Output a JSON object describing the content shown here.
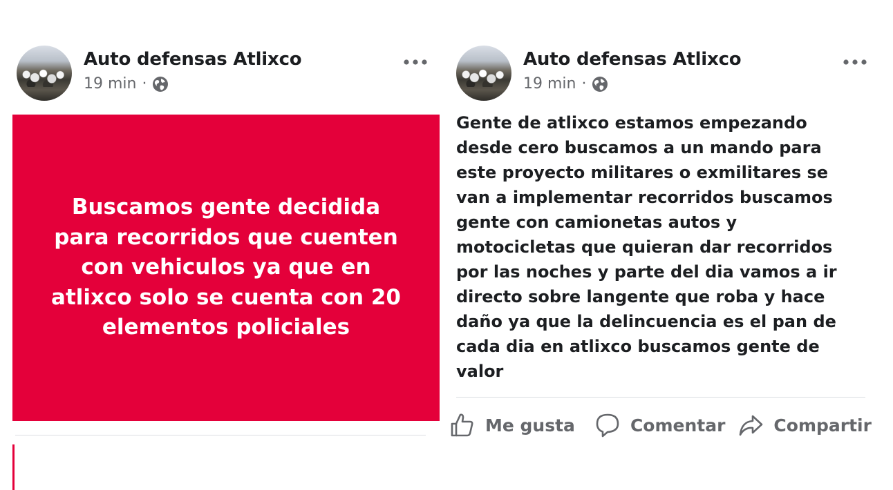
{
  "left_post": {
    "author": "Auto defensas Atlixco",
    "time": "19 min",
    "separator": "·",
    "audience_icon": "globe-icon",
    "menu_icon": "more-options-icon",
    "card": {
      "text": "Buscamos gente decidida\npara recorridos que cuenten\ncon vehiculos ya que en\natlixco solo se cuenta con 20\nelementos policiales",
      "background": "#e4003a",
      "text_color": "#ffffff"
    }
  },
  "right_post": {
    "author": "Auto defensas Atlixco",
    "time": "19 min",
    "separator": "·",
    "audience_icon": "globe-icon",
    "menu_icon": "more-options-icon",
    "text": "Gente de atlixco estamos empezando\ndesde cero buscamos a un mando para\neste proyecto militares o exmilitares se\nvan a implementar recorridos buscamos\ngente con camionetas autos y\nmotocicletas que quieran dar recorridos\npor las noches y parte del dia vamos a ir\ndirecto sobre langente que roba y hace\ndaño ya que la delincuencia es el pan de\ncada dia en atlixco buscamos gente de\nvalor",
    "actions": {
      "like": {
        "label": "Me gusta",
        "icon": "thumbs-up-icon"
      },
      "comment": {
        "label": "Comentar",
        "icon": "comment-icon"
      },
      "share": {
        "label": "Compartir",
        "icon": "share-icon"
      }
    }
  },
  "colors": {
    "accent": "#e4003a",
    "text_primary": "#1c1e21",
    "text_secondary": "#65676b",
    "divider": "#dadde1"
  }
}
